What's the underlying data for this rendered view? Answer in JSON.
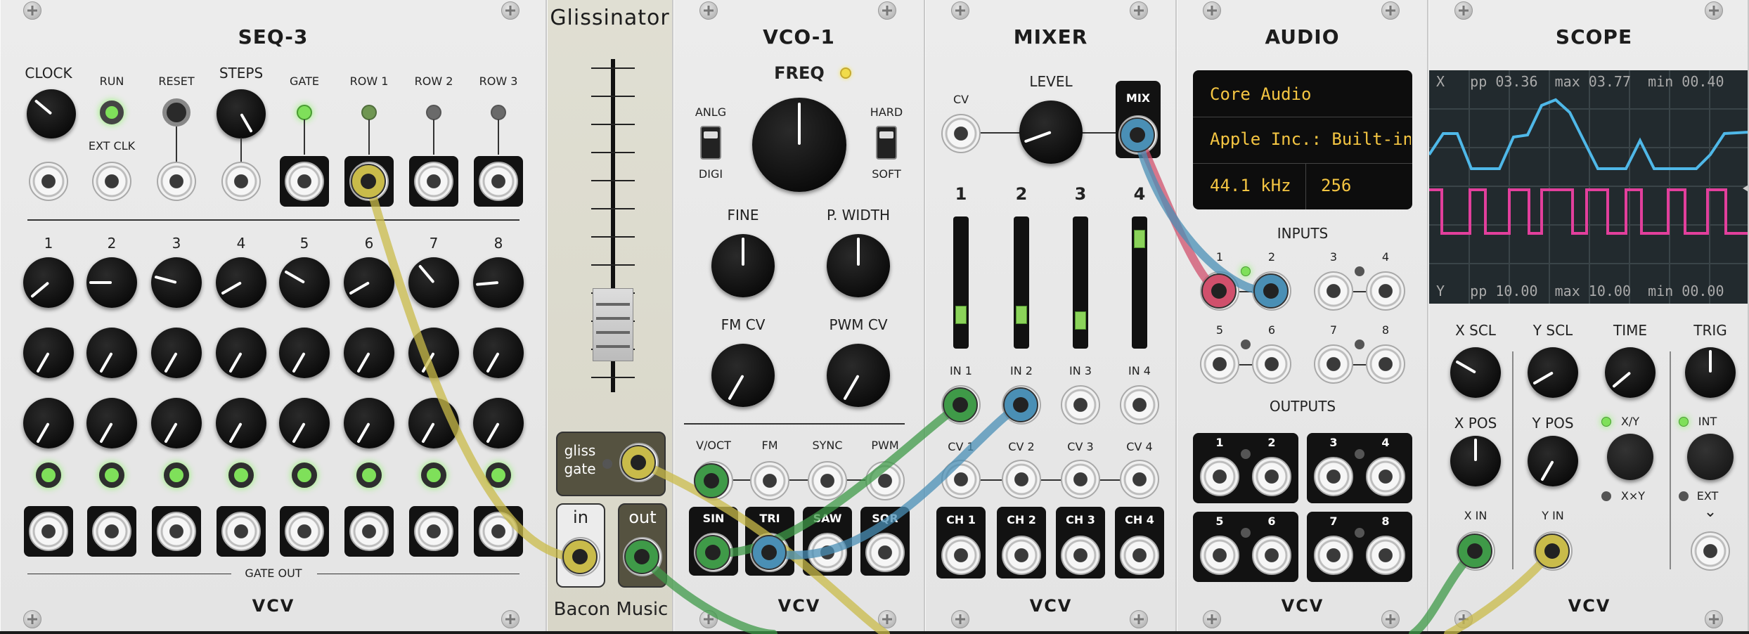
{
  "brand": "VCV",
  "seq3": {
    "title": "SEQ-3",
    "labels": {
      "clock": "CLOCK",
      "run": "RUN",
      "reset": "RESET",
      "steps": "STEPS",
      "gate": "GATE",
      "row1": "ROW 1",
      "row2": "ROW 2",
      "row3": "ROW 3",
      "ext_clk": "EXT CLK",
      "gate_out": "GATE OUT"
    },
    "steps": [
      "1",
      "2",
      "3",
      "4",
      "5",
      "6",
      "7",
      "8"
    ]
  },
  "glissinator": {
    "title": "Glissinator",
    "gliss_gate": "gliss gate",
    "in": "in",
    "out": "out",
    "maker": "Bacon Music"
  },
  "vco1": {
    "title": "VCO-1",
    "freq": "FREQ",
    "anlg": "ANLG",
    "digi": "DIGI",
    "hard": "HARD",
    "soft": "SOFT",
    "fine": "FINE",
    "pwidth": "P. WIDTH",
    "fmcv": "FM CV",
    "pwmcv": "PWM CV",
    "inputs": [
      "V/OCT",
      "FM",
      "SYNC",
      "PWM"
    ],
    "outputs": [
      "SIN",
      "TRI",
      "SAW",
      "SQR"
    ]
  },
  "mixer": {
    "title": "MIXER",
    "level": "LEVEL",
    "cv": "CV",
    "mix": "MIX",
    "channels": [
      "1",
      "2",
      "3",
      "4"
    ],
    "levels": [
      0.2,
      0.2,
      0.15,
      0.9
    ],
    "ins": [
      "IN 1",
      "IN 2",
      "IN 3",
      "IN 4"
    ],
    "cvs": [
      "CV 1",
      "CV 2",
      "CV 3",
      "CV 4"
    ],
    "chs": [
      "CH 1",
      "CH 2",
      "CH 3",
      "CH 4"
    ]
  },
  "audio": {
    "title": "AUDIO",
    "driver": "Core Audio",
    "device": "Apple Inc.: Built-in",
    "sample_rate": "44.1 kHz",
    "block_size": "256",
    "inputs_label": "INPUTS",
    "outputs_label": "OUTPUTS",
    "ports": [
      "1",
      "2",
      "3",
      "4",
      "5",
      "6",
      "7",
      "8"
    ]
  },
  "scope": {
    "title": "SCOPE",
    "readout_x": {
      "ch": "X",
      "pp": "pp",
      "pp_val": "03.36",
      "max": "max",
      "max_val": "03.77",
      "min": "min",
      "min_val": "00.40"
    },
    "readout_y": {
      "ch": "Y",
      "pp": "pp",
      "pp_val": "10.00",
      "max": "max",
      "max_val": "10.00",
      "min": "min",
      "min_val": "00.00"
    },
    "xscl": "X SCL",
    "yscl": "Y SCL",
    "time": "TIME",
    "trig": "TRIG",
    "xpos": "X POS",
    "ypos": "Y POS",
    "xy": "X/Y",
    "xxy": "X×Y",
    "int": "INT",
    "ext": "EXT",
    "xin": "X IN",
    "yin": "Y IN",
    "chevron": "⌄",
    "colors": {
      "x": "#4fb8e8",
      "y": "#e23f9c"
    }
  }
}
